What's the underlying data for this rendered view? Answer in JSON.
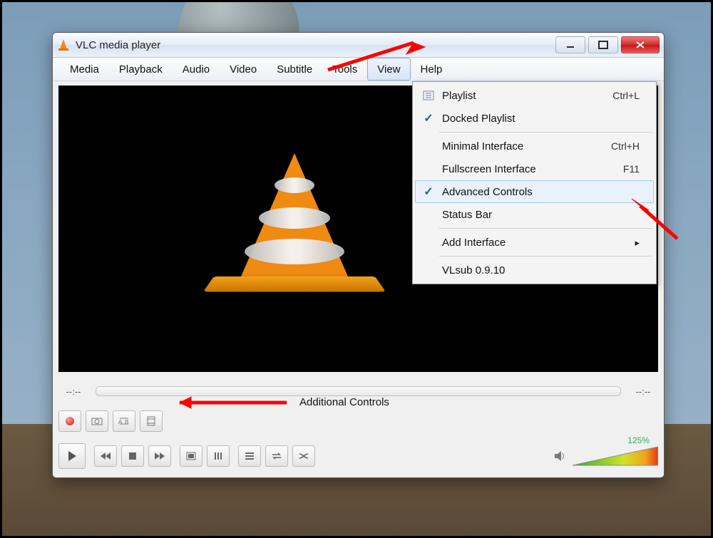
{
  "window": {
    "title": "VLC media player"
  },
  "menubar": [
    "Media",
    "Playback",
    "Audio",
    "Video",
    "Subtitle",
    "Tools",
    "View",
    "Help"
  ],
  "active_menu_index": 6,
  "dropdown": {
    "items": [
      {
        "label": "Playlist",
        "shortcut": "Ctrl+L",
        "icon": "list"
      },
      {
        "label": "Docked Playlist",
        "checked": true
      },
      {
        "sep": true
      },
      {
        "label": "Minimal Interface",
        "shortcut": "Ctrl+H"
      },
      {
        "label": "Fullscreen Interface",
        "shortcut": "F11"
      },
      {
        "label": "Advanced Controls",
        "checked": true,
        "highlight": true
      },
      {
        "label": "Status Bar"
      },
      {
        "sep": true
      },
      {
        "label": "Add Interface",
        "submenu": true
      },
      {
        "sep": true
      },
      {
        "label": "VLsub 0.9.10"
      }
    ]
  },
  "time": {
    "elapsed": "--:--",
    "remaining": "--:--"
  },
  "volume": {
    "percent": "125%"
  },
  "annotation": {
    "additional_controls": "Additional Controls"
  }
}
